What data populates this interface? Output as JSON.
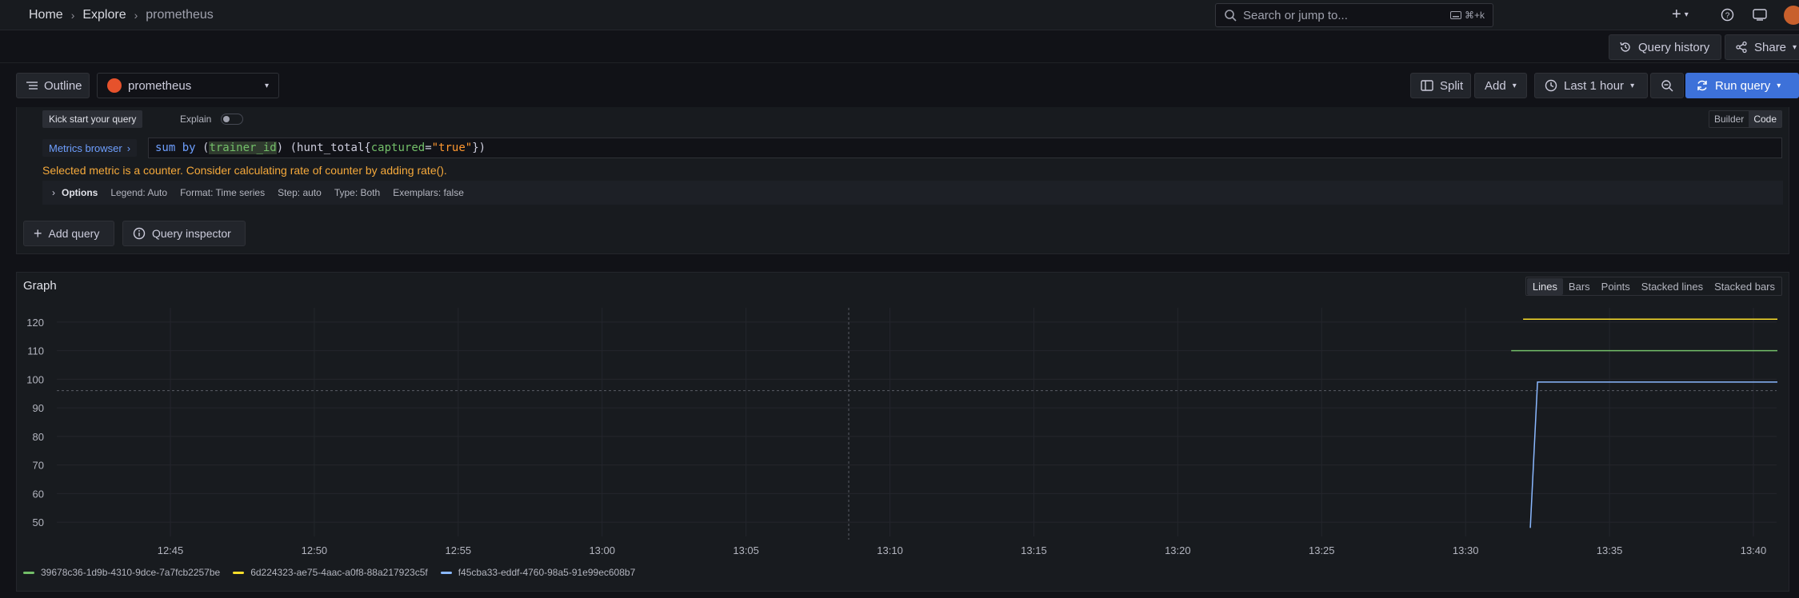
{
  "breadcrumbs": [
    "Home",
    "Explore",
    "prometheus"
  ],
  "search": {
    "placeholder": "Search or jump to...",
    "shortcut": "⌘+k"
  },
  "header_actions": {
    "query_history": "Query history",
    "share": "Share"
  },
  "toolbar": {
    "outline": "Outline",
    "datasource": "prometheus",
    "split": "Split",
    "add": "Add",
    "time_range": "Last 1 hour",
    "run_query": "Run query"
  },
  "query": {
    "kick_start": "Kick start your query",
    "explain": "Explain",
    "builder": "Builder",
    "code": "Code",
    "metrics_browser": "Metrics browser",
    "expr_parts": {
      "kw": "sum by",
      "open": " (",
      "label": "trainer_id",
      "mid": ") (hunt_total{",
      "matcher_key": "captured",
      "eq": "=",
      "matcher_val": "\"true\"",
      "close": "})"
    },
    "warning": "Selected metric is a counter. Consider calculating rate of counter by adding rate().",
    "options": {
      "title": "Options",
      "legend": "Legend: Auto",
      "format": "Format: Time series",
      "step": "Step: auto",
      "type": "Type: Both",
      "exemplars": "Exemplars: false"
    },
    "add_query": "Add query",
    "query_inspector": "Query inspector"
  },
  "graph": {
    "title": "Graph",
    "modes": [
      "Lines",
      "Bars",
      "Points",
      "Stacked lines",
      "Stacked bars"
    ],
    "active_mode": "Lines"
  },
  "colors": {
    "accent": "#3d71d9",
    "warning": "#f5a93b",
    "green": "#73bf69",
    "yellow": "#fade2a",
    "blue": "#8ab8ff"
  },
  "chart_data": {
    "type": "line",
    "x_ticks": [
      "12:45",
      "12:50",
      "12:55",
      "13:00",
      "13:05",
      "13:10",
      "13:15",
      "13:20",
      "13:25",
      "13:30",
      "13:35",
      "13:40"
    ],
    "y_ticks": [
      50,
      60,
      70,
      80,
      90,
      100,
      110,
      120
    ],
    "ylim": [
      45,
      125
    ],
    "grid": true,
    "legend_position": "bottom",
    "series": [
      {
        "name": "39678c36-1d9b-4310-9dce-7a7fcb2257be",
        "color": "#73bf69",
        "points": [
          [
            "13:31:35",
            110
          ],
          [
            "13:40:50",
            110
          ]
        ]
      },
      {
        "name": "6d224323-ae75-4aac-a0f8-88a217923c5f",
        "color": "#fade2a",
        "points": [
          [
            "13:32:00",
            121
          ],
          [
            "13:40:50",
            121
          ]
        ]
      },
      {
        "name": "f45cba33-eddf-4760-98a5-91e99ec608b7",
        "color": "#8ab8ff",
        "points": [
          [
            "13:32:15",
            48
          ],
          [
            "13:32:30",
            99
          ],
          [
            "13:40:50",
            99
          ]
        ]
      }
    ]
  }
}
